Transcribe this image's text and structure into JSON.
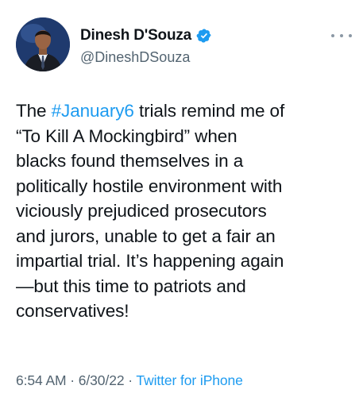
{
  "tweet": {
    "author": {
      "display_name": "Dinesh D'Souza",
      "handle": "@DineshDSouza",
      "verified": true,
      "avatar_icon": "profile-photo"
    },
    "more_icon": "more-options-icon",
    "body": {
      "line1_prefix": "The ",
      "hashtag": "#January6",
      "line1_suffix": " trials remind me of",
      "line2": "“To Kill A Mockingbird” when",
      "line3": "blacks found themselves in a",
      "line4": "politically hostile environment with",
      "line5": "viciously prejudiced prosecutors",
      "line6": "and jurors, unable to get a fair an",
      "line7": "impartial trial. It’s happening again",
      "line8": "—but this time to patriots and",
      "line9": "conservatives!"
    },
    "meta": {
      "time": "6:54 AM",
      "sep1": " · ",
      "date": "6/30/22",
      "sep2": " · ",
      "source": "Twitter for iPhone"
    }
  },
  "colors": {
    "text": "#0f1419",
    "secondary": "#536471",
    "accent": "#1d9bf0",
    "background": "#ffffff"
  }
}
